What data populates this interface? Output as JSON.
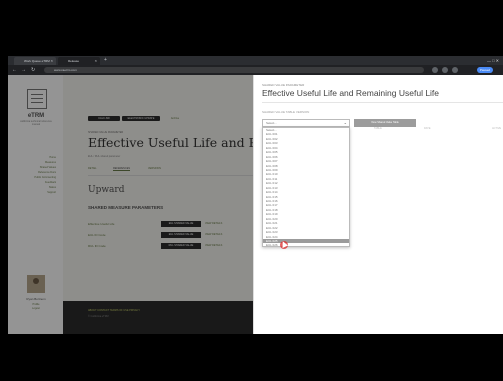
{
  "browser": {
    "tabs": [
      {
        "label": "Work Queue eTRM",
        "active": false
      },
      {
        "label": "Release",
        "active": true
      }
    ],
    "url": "www.caetrm.com",
    "profile": "Paused"
  },
  "sidebar": {
    "logo_text": "eTRM",
    "logo_sub": "california technical reference manual",
    "links": [
      "Home",
      "Measures",
      "Shared Values",
      "Reference Docs",
      "Public Commenting",
      "Feedback",
      "Status",
      "Support"
    ],
    "user_name": "Ryan Bortnem",
    "user_links": [
      "Profile",
      "Logout"
    ]
  },
  "main": {
    "pills": [
      "CALC-SW",
      "ELECTRONIC UPDATE",
      "Archive"
    ],
    "breadcrumb": "SHARED VALUE PARAMETER",
    "title": "Effective Useful Life and Remaining",
    "subline": "EUL / RUL shared parameter",
    "tabs": [
      "DETAIL",
      "REFERENCES",
      "VERSIONS"
    ],
    "section_title": "Upward",
    "section_sub": "SHARED MEASURE PARAMETERS",
    "params": [
      {
        "label": "Effective Useful Life",
        "button": "EUL   SHARED VALUE",
        "link": "VIEW DETAILS"
      },
      {
        "label": "EUL ID Code",
        "button": "EUL   SHARED VALUE",
        "link": "VIEW DETAILS"
      },
      {
        "label": "RUL ID Code",
        "button": "RUL   SHARED VALUE",
        "link": "VIEW DETAILS"
      }
    ],
    "footer_links": "ABOUT   CONTACT   TERMS OF USE   PRIVACY",
    "footer_sub": "© California eTRM"
  },
  "panel": {
    "crumb": "SHARED VALUE PARAMETER",
    "title": "Effective Useful Life and Remaining Useful Life",
    "select_label": "SHARED VALUE TABLE VERSION",
    "select_value": "Select...",
    "button": "View Shared Value Table",
    "col_headers": [
      "TABLE",
      "DATE",
      "ACTIVE"
    ],
    "options": [
      "Select...",
      "EUL 001",
      "EUL 002",
      "EUL 003",
      "EUL 004",
      "EUL 005",
      "EUL 006",
      "EUL 007",
      "EUL 008",
      "EUL 009",
      "EUL 010",
      "EUL 011",
      "EUL 012",
      "EUL 013",
      "EUL 014",
      "EUL 015",
      "EUL 016",
      "EUL 017",
      "EUL 018",
      "EUL 019",
      "EUL 020",
      "EUL 021",
      "EUL 022",
      "EUL 023",
      "EUL 024",
      "EUL 025",
      "EUL 026"
    ],
    "selected_index": 25
  }
}
